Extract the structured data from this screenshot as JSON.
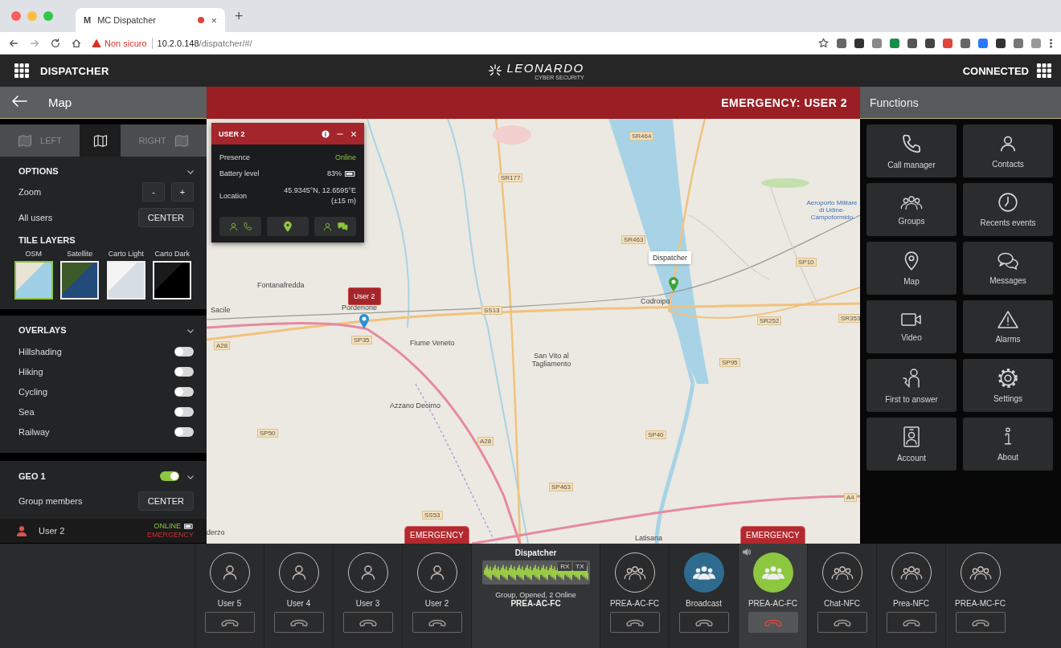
{
  "browser": {
    "favicon": "M",
    "tab_title": "MC Dispatcher",
    "tab_close": "×",
    "new_tab": "+",
    "security": "Non sicuro",
    "url_host": "10.2.0.148",
    "url_path": "/dispatcher/#/"
  },
  "header": {
    "app_name": "DISPATCHER",
    "logo": "LEONARDO",
    "logo_sub": "CYBER SECURITY",
    "status": "CONNECTED"
  },
  "left": {
    "title": "Map",
    "view_tabs": [
      {
        "label": "LEFT",
        "selected": false
      },
      {
        "selected": true
      },
      {
        "label": "RIGHT",
        "selected": false
      }
    ],
    "options": {
      "title": "OPTIONS",
      "zoom_label": "Zoom",
      "zoom_buttons": [
        "-",
        "+"
      ],
      "all_users_label": "All users",
      "center_button": "CENTER",
      "tile_layers_title": "TILE LAYERS",
      "tile_layers": [
        {
          "name": "OSM",
          "selected": true
        },
        {
          "name": "Satellite",
          "selected": false
        },
        {
          "name": "Carto Light",
          "selected": false
        },
        {
          "name": "Carto Dark",
          "selected": false
        }
      ]
    },
    "overlays": {
      "title": "OVERLAYS",
      "items": [
        {
          "label": "Hillshading",
          "on": false
        },
        {
          "label": "Hiking",
          "on": false
        },
        {
          "label": "Cycling",
          "on": false
        },
        {
          "label": "Sea",
          "on": false
        },
        {
          "label": "Railway",
          "on": false
        }
      ]
    },
    "geo": {
      "title": "GEO 1",
      "on": true,
      "group_members_label": "Group members",
      "center_button": "CENTER",
      "members": [
        {
          "name": "User 2",
          "presence": "ONLINE",
          "status": "EMERGENCY"
        }
      ]
    }
  },
  "map": {
    "banner": "EMERGENCY: USER 2",
    "places": [
      {
        "text": "Fontanafredda",
        "kind": "town"
      },
      {
        "text": "Sacile",
        "kind": "town"
      },
      {
        "text": "Pordenone",
        "kind": "town"
      },
      {
        "text": "Fiume Veneto",
        "kind": "town"
      },
      {
        "text": "San Vito al Tagliamento",
        "kind": "town"
      },
      {
        "text": "Azzano Decimo",
        "kind": "town"
      },
      {
        "text": "Codroipo",
        "kind": "town"
      },
      {
        "text": "Latisana",
        "kind": "town"
      },
      {
        "text": "derzo",
        "kind": "town"
      },
      {
        "text": "Aeroporto Militare di Udine-Campoformido",
        "kind": "airport"
      },
      {
        "text": "SR464",
        "kind": "road"
      },
      {
        "text": "SR177",
        "kind": "road"
      },
      {
        "text": "SR463",
        "kind": "road"
      },
      {
        "text": "SP10",
        "kind": "road"
      },
      {
        "text": "SS13",
        "kind": "road"
      },
      {
        "text": "SR252",
        "kind": "road"
      },
      {
        "text": "SR353",
        "kind": "road"
      },
      {
        "text": "SP95",
        "kind": "road"
      },
      {
        "text": "SP35",
        "kind": "road"
      },
      {
        "text": "A28",
        "kind": "road"
      },
      {
        "text": "A28",
        "kind": "road"
      },
      {
        "text": "SP50",
        "kind": "road"
      },
      {
        "text": "SP40",
        "kind": "road"
      },
      {
        "text": "SP463",
        "kind": "road"
      },
      {
        "text": "SS53",
        "kind": "road"
      },
      {
        "text": "A4",
        "kind": "road"
      }
    ],
    "user_tag": "User 2",
    "dispatcher_tooltip": "Dispatcher",
    "popup": {
      "title": "USER 2",
      "rows": [
        {
          "label": "Presence",
          "value": "Online"
        },
        {
          "label": "Battery level",
          "value": "83%"
        },
        {
          "label": "Location",
          "value": "45.9345°N, 12.6595°E",
          "extra": "(±15 m)"
        }
      ]
    }
  },
  "functions": {
    "title": "Functions",
    "items": [
      "Call manager",
      "Contacts",
      "Groups",
      "Recents events",
      "Map",
      "Messages",
      "Video",
      "Alarms",
      "First to answer",
      "Settings",
      "Account",
      "About"
    ]
  },
  "calls": {
    "items": [
      {
        "kind": "user",
        "label": "User 5",
        "in_call": false
      },
      {
        "kind": "user",
        "label": "User 4",
        "in_call": false
      },
      {
        "kind": "user",
        "label": "User 3",
        "in_call": false
      },
      {
        "kind": "user",
        "label": "User 2",
        "in_call": false,
        "emergency_tag": "EMERGENCY"
      },
      {
        "kind": "dispatcher",
        "title": "Dispatcher",
        "rx": "RX",
        "tx": "TX",
        "status": "Group, Opened, 2 Online",
        "group": "PREA-AC-FC"
      },
      {
        "kind": "group",
        "label": "PREA-AC-FC",
        "in_call": false
      },
      {
        "kind": "group",
        "label": "Broadcast",
        "in_call": false,
        "color": "#2f6b8e"
      },
      {
        "kind": "group",
        "label": "PREA-AC-FC",
        "in_call": true,
        "color": "#8dc63f",
        "emergency_tag": "EMERGENCY"
      },
      {
        "kind": "group",
        "label": "Chat-NFC",
        "in_call": false
      },
      {
        "kind": "group",
        "label": "Prea-NFC",
        "in_call": false
      },
      {
        "kind": "group",
        "label": "PREA-MC-FC",
        "in_call": false
      }
    ]
  }
}
